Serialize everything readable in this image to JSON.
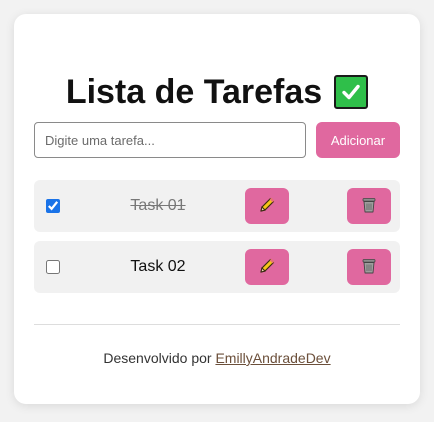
{
  "header": {
    "title": "Lista de Tarefas",
    "title_icon": "check-mark-button-icon"
  },
  "form": {
    "placeholder": "Digite uma tarefa...",
    "value": "",
    "add_label": "Adicionar"
  },
  "tasks": [
    {
      "text": "Task 01",
      "completed": true
    },
    {
      "text": "Task 02",
      "completed": false
    }
  ],
  "footer": {
    "prefix": "Desenvolvido por",
    "author": "EmillyAndradeDev"
  },
  "colors": {
    "accent": "#e0689f",
    "background": "#f2f2f2",
    "card": "#ffffff",
    "row": "#f1f1f1",
    "check_icon": "#2fbf4a"
  }
}
